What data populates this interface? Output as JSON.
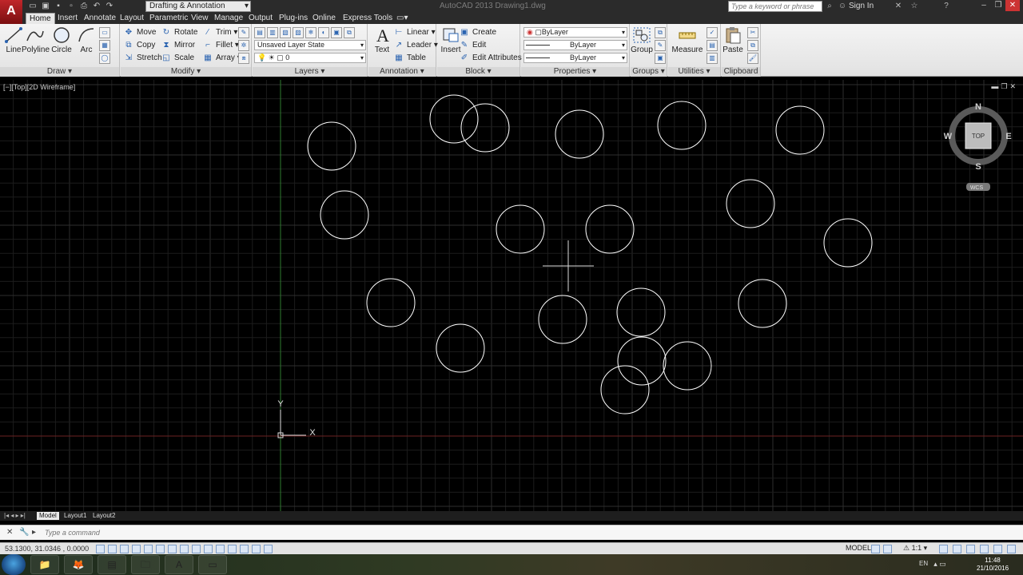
{
  "title_bar": {
    "app_logo": "A",
    "workspace": "Drafting & Annotation",
    "window_title": "AutoCAD 2013   Drawing1.dwg",
    "search_placeholder": "Type a keyword or phrase",
    "sign_in": "Sign In"
  },
  "tabs": [
    "Home",
    "Insert",
    "Annotate",
    "Layout",
    "Parametric",
    "View",
    "Manage",
    "Output",
    "Plug-ins",
    "Online",
    "Express Tools"
  ],
  "ribbon": {
    "draw": {
      "title": "Draw",
      "tools": [
        "Line",
        "Polyline",
        "Circle",
        "Arc"
      ]
    },
    "modify": {
      "title": "Modify",
      "tools": [
        "Move",
        "Rotate",
        "Trim",
        "Copy",
        "Mirror",
        "Fillet",
        "Stretch",
        "Scale",
        "Array"
      ]
    },
    "layers": {
      "title": "Layers",
      "layer_state": "Unsaved Layer State",
      "current_layer": "0"
    },
    "annotation": {
      "title": "Annotation",
      "text": "Text",
      "tools": [
        "Linear",
        "Leader",
        "Table"
      ]
    },
    "block": {
      "title": "Block",
      "insert": "Insert",
      "tools": [
        "Create",
        "Edit",
        "Edit Attributes"
      ]
    },
    "properties": {
      "title": "Properties",
      "color": "ByLayer",
      "linetype": "ByLayer",
      "lineweight": "ByLayer"
    },
    "groups": {
      "title": "Groups",
      "group": "Group"
    },
    "utilities": {
      "title": "Utilities",
      "measure": "Measure"
    },
    "clipboard": {
      "title": "Clipboard",
      "paste": "Paste"
    }
  },
  "viewport": {
    "label": "[−][Top][2D Wireframe]",
    "viewcube": {
      "north": "N",
      "south": "S",
      "east": "E",
      "west": "W",
      "face": "TOP",
      "ucs": "WCS"
    },
    "ucs_axes": {
      "x": "X",
      "y": "Y"
    }
  },
  "layout_tabs": [
    "Model",
    "Layout1",
    "Layout2"
  ],
  "command_line": {
    "placeholder": "Type a command"
  },
  "status_bar": {
    "coordinates": "53.1300, 31.0346 , 0.0000",
    "model": "MODEL",
    "annotation_scale": "1:1"
  },
  "taskbar": {
    "language": "EN",
    "time": "11:48",
    "date": "21/10/2016"
  },
  "colors": {
    "background": "#000000",
    "circle_stroke": "#ffffff",
    "grid_minor": "#1c1c1c",
    "grid_major": "#2e2e2e",
    "y_axis": "#2f7d2f",
    "x_axis": "#6b2222",
    "app_logo": "#c0262a"
  },
  "icons": {
    "qat": [
      "new-icon",
      "open-icon",
      "save-icon",
      "saveas-icon",
      "plot-icon",
      "undo-icon",
      "redo-icon"
    ],
    "window_controls": [
      "minimize-icon",
      "restore-icon",
      "close-icon"
    ]
  }
}
